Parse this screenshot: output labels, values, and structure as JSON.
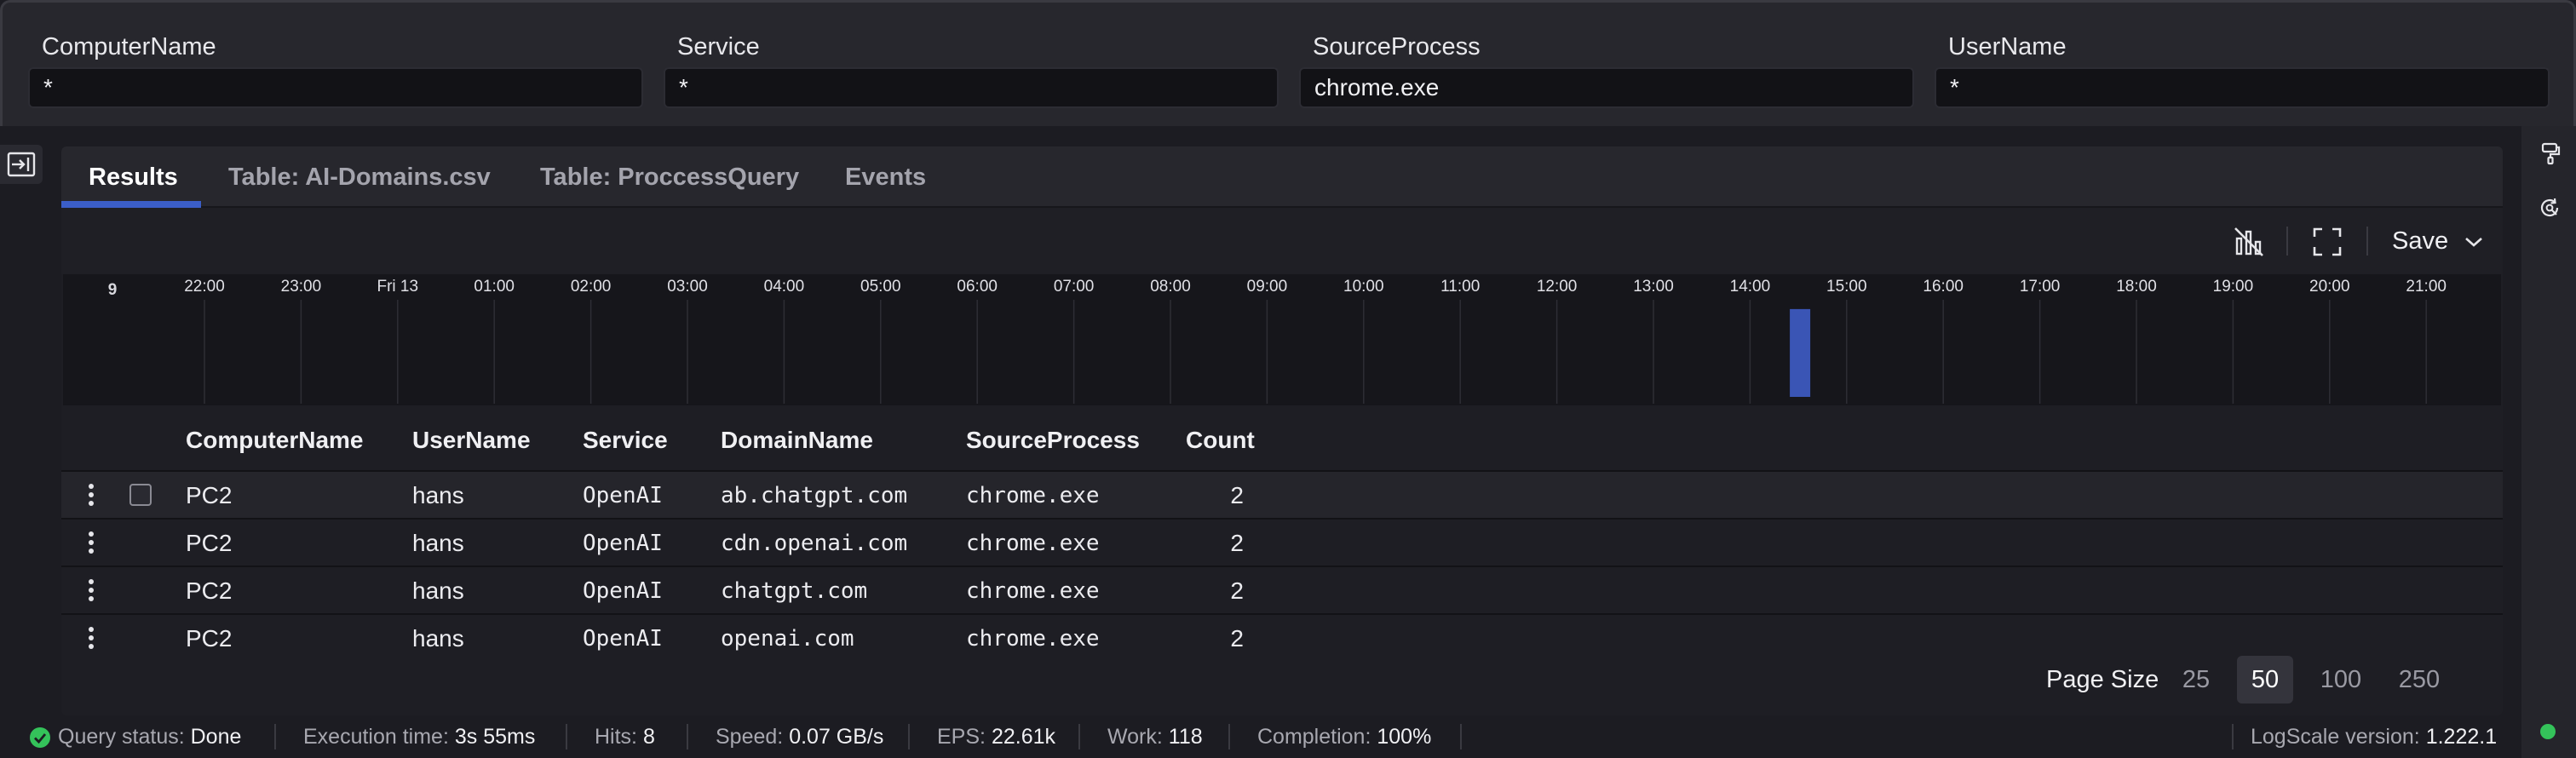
{
  "parameters": [
    {
      "label": "ComputerName",
      "value": "*"
    },
    {
      "label": "Service",
      "value": "*"
    },
    {
      "label": "SourceProcess",
      "value": "chrome.exe"
    },
    {
      "label": "UserName",
      "value": "*"
    }
  ],
  "tabs": [
    {
      "label": "Results",
      "active": true
    },
    {
      "label": "Table: AI-Domains.csv",
      "active": false
    },
    {
      "label": "Table: ProccessQuery",
      "active": false
    },
    {
      "label": "Events",
      "active": false
    }
  ],
  "toolbar": {
    "save_label": "Save"
  },
  "timeline": {
    "y_max_label": "9",
    "hour_labels": [
      "22:00",
      "23:00",
      "Fri 13",
      "01:00",
      "02:00",
      "03:00",
      "04:00",
      "05:00",
      "06:00",
      "07:00",
      "08:00",
      "09:00",
      "10:00",
      "11:00",
      "12:00",
      "13:00",
      "14:00",
      "15:00",
      "16:00",
      "17:00",
      "18:00",
      "19:00",
      "20:00",
      "21:00"
    ],
    "bar": {
      "hour_index": 16.5,
      "value": 8,
      "y_max": 9
    },
    "bar_color": "#3a55b5"
  },
  "table": {
    "columns": [
      "ComputerName",
      "UserName",
      "Service",
      "DomainName",
      "SourceProcess",
      "Count"
    ],
    "rows": [
      [
        "PC2",
        "hans",
        "OpenAI",
        "ab.chatgpt.com",
        "chrome.exe",
        "2"
      ],
      [
        "PC2",
        "hans",
        "OpenAI",
        "cdn.openai.com",
        "chrome.exe",
        "2"
      ],
      [
        "PC2",
        "hans",
        "OpenAI",
        "chatgpt.com",
        "chrome.exe",
        "2"
      ],
      [
        "PC2",
        "hans",
        "OpenAI",
        "openai.com",
        "chrome.exe",
        "2"
      ]
    ]
  },
  "pagination": {
    "label": "Page Size",
    "options": [
      "25",
      "50",
      "100",
      "250"
    ],
    "selected": "50"
  },
  "status": {
    "query_status_label": "Query status:",
    "query_status_value": "Done",
    "exec_label": "Execution time:",
    "exec_value": "3s 55ms",
    "hits_label": "Hits:",
    "hits_value": "8",
    "speed_label": "Speed:",
    "speed_value": "0.07 GB/s",
    "eps_label": "EPS:",
    "eps_value": "22.61k",
    "work_label": "Work:",
    "work_value": "118",
    "completion_label": "Completion:",
    "completion_value": "100%",
    "version_label": "LogScale version:",
    "version_value": "1.222.1"
  },
  "colors": {
    "accent": "#3b5ec8",
    "success": "#34c25a"
  }
}
